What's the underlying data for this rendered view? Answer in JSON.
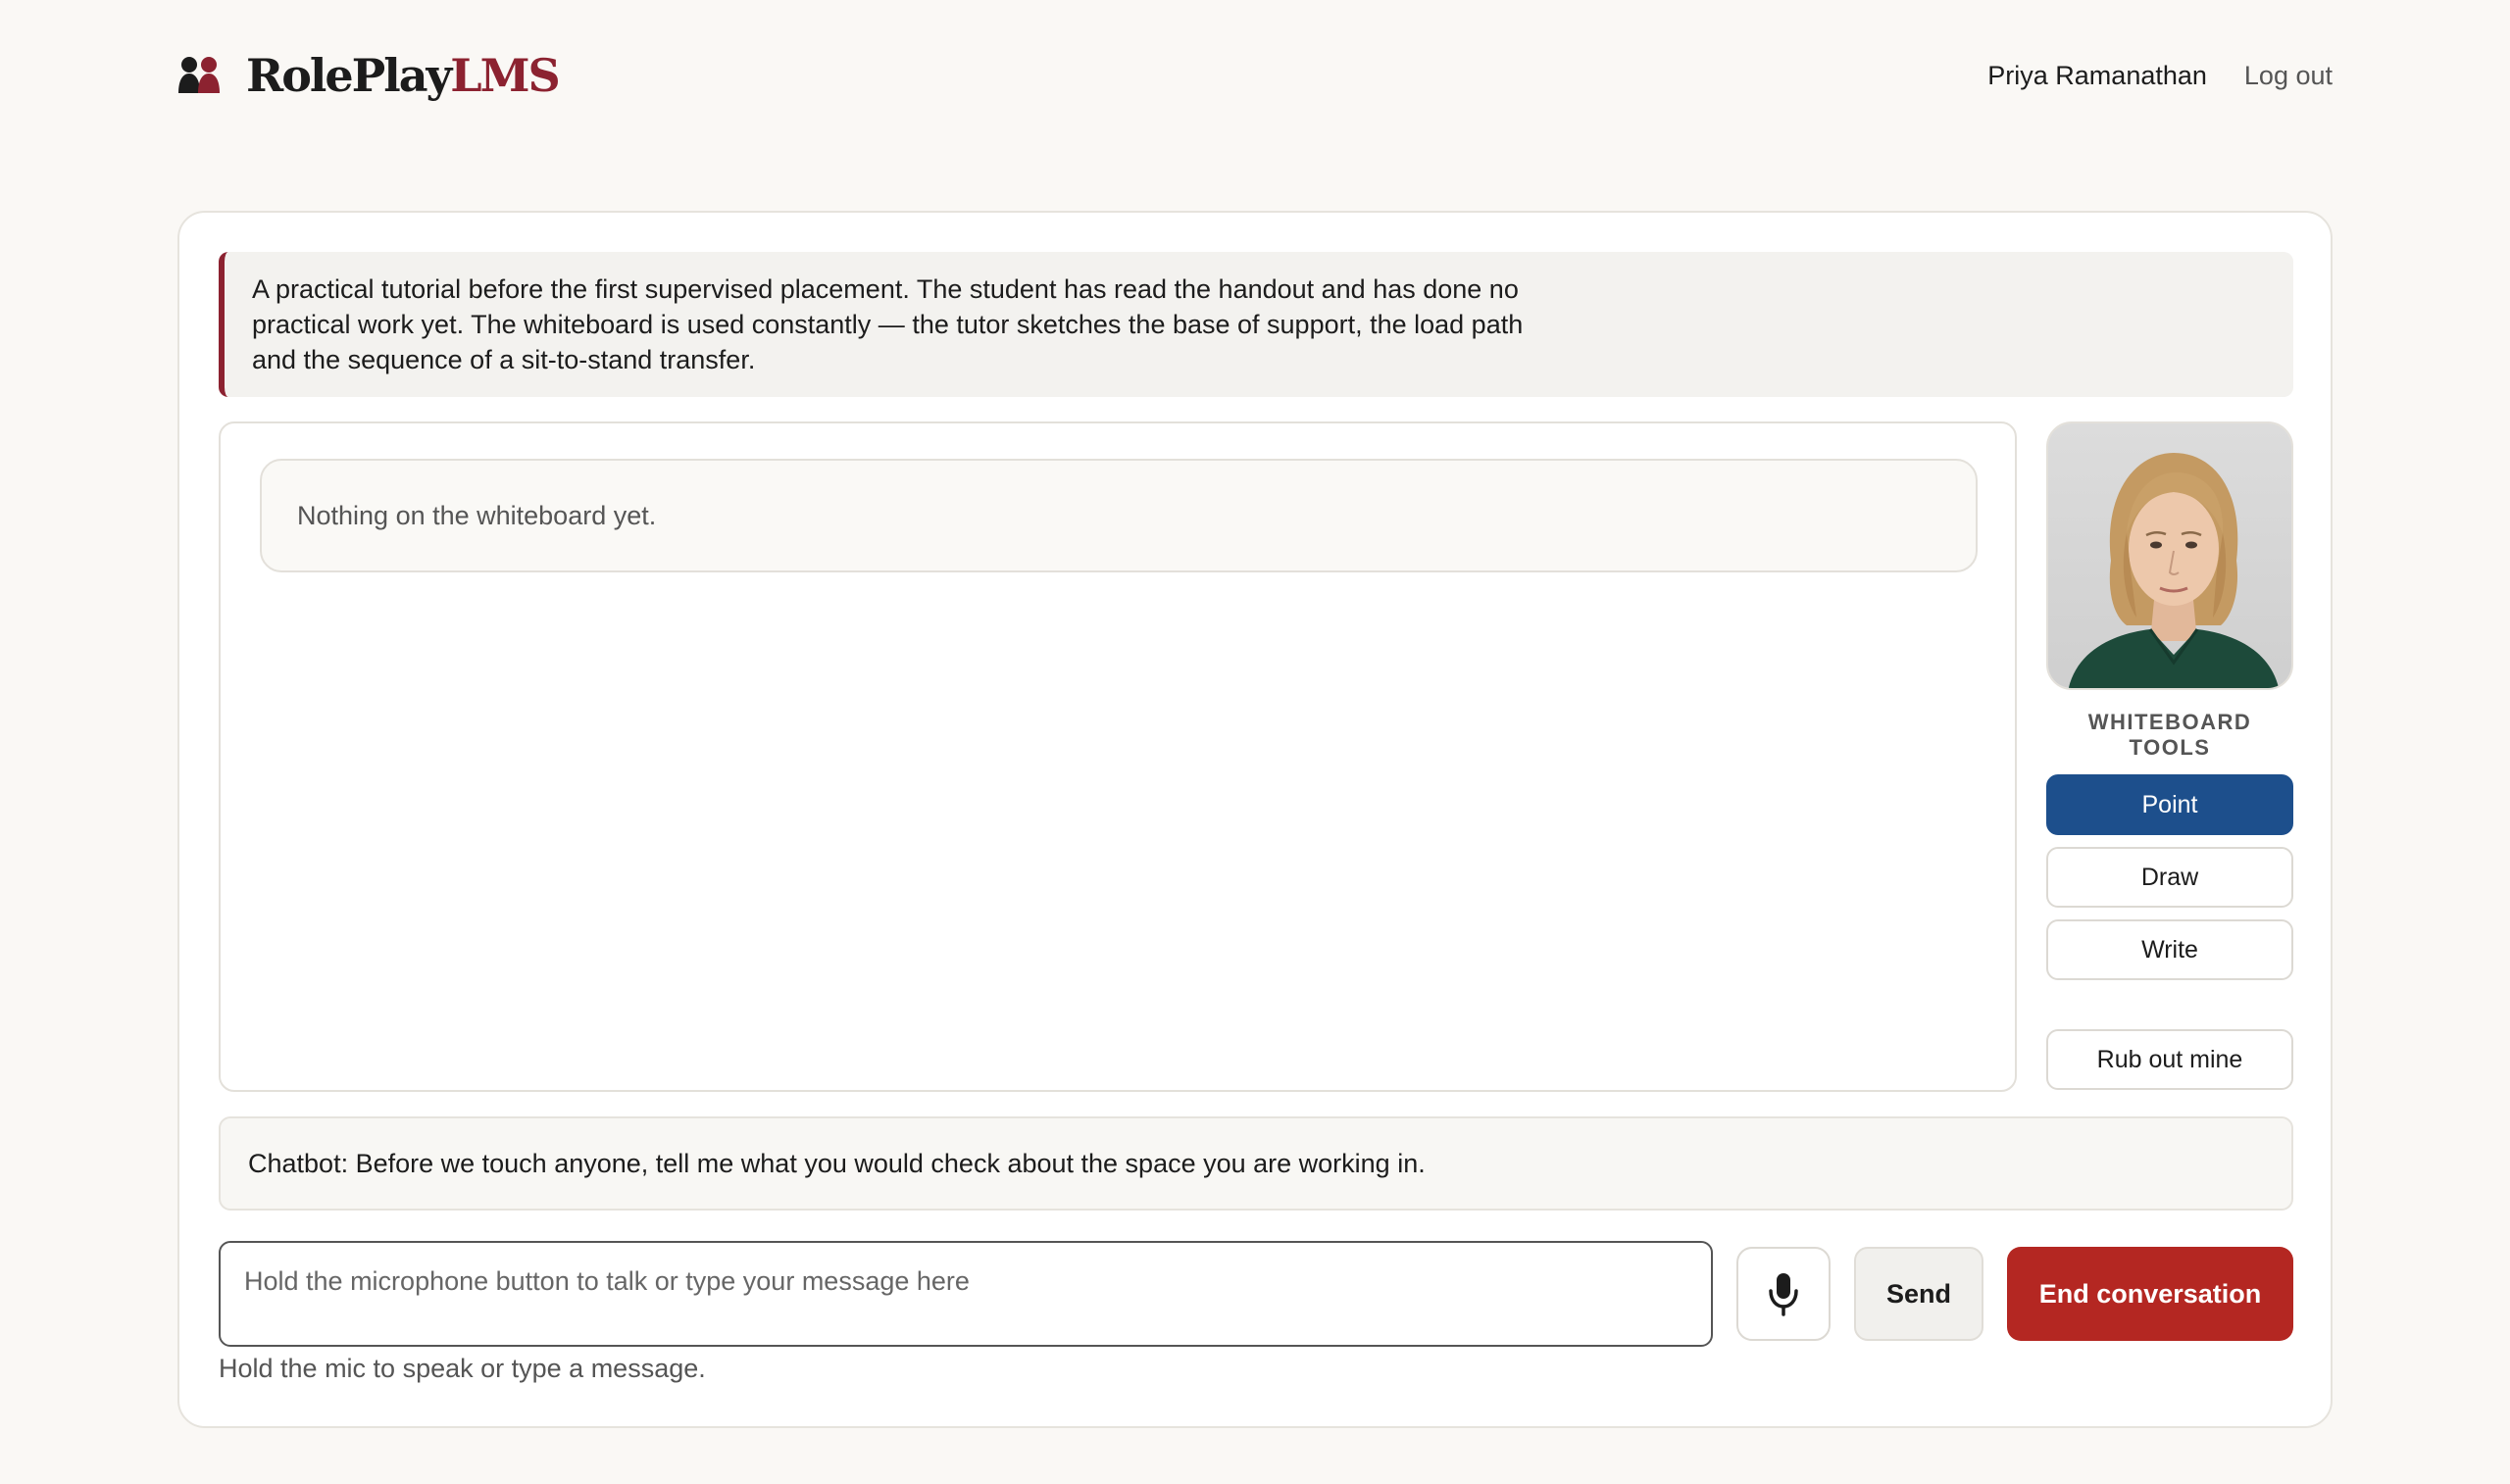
{
  "header": {
    "brand_main": "RolePlay",
    "brand_accent": "LMS",
    "user_name": "Priya Ramanathan",
    "logout_label": "Log out"
  },
  "scenario": {
    "text": "A practical tutorial before the first supervised placement. The student has read the handout and has done no practical work yet. The whiteboard is used constantly — the tutor sketches the base of support, the load path and the sequence of a sit-to-stand transfer."
  },
  "whiteboard": {
    "empty_message": "Nothing on the whiteboard yet."
  },
  "sidebar": {
    "avatar_icon": "tutor-portrait",
    "tools_label": "WHITEBOARD TOOLS",
    "tools": [
      {
        "label": "Point",
        "active": true
      },
      {
        "label": "Draw",
        "active": false
      },
      {
        "label": "Write",
        "active": false
      }
    ],
    "rub_out_label": "Rub out mine"
  },
  "chat": {
    "last_message": "Chatbot: Before we touch anyone, tell me what you would check about the space you are working in."
  },
  "composer": {
    "placeholder": "Hold the microphone button to talk or type your message here",
    "value": "",
    "mic_icon": "microphone-icon",
    "send_label": "Send",
    "end_label": "End conversation",
    "hint": "Hold the mic to speak or type a message."
  },
  "colors": {
    "brand_accent": "#8c2230",
    "active_tool": "#1d4f8c",
    "end_button": "#b42722",
    "background": "#faf8f5"
  }
}
